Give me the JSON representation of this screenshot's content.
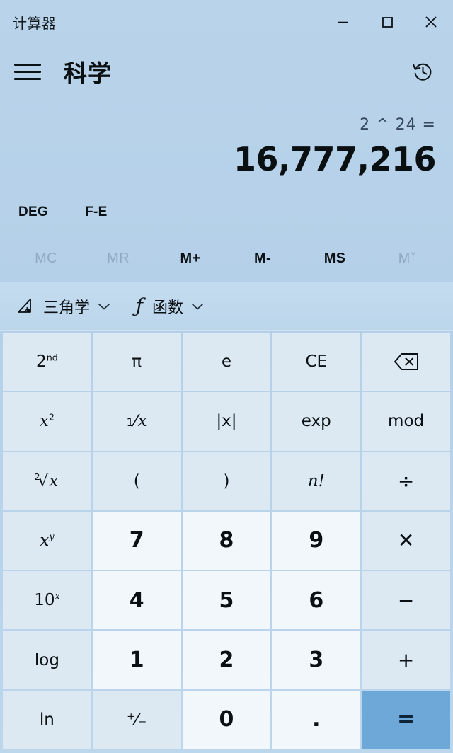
{
  "window": {
    "title": "计算器",
    "controls": [
      {
        "name": "minimize",
        "glyph": "minimize-icon"
      },
      {
        "name": "maximize",
        "glyph": "maximize-icon"
      },
      {
        "name": "close",
        "glyph": "close-icon"
      }
    ]
  },
  "header": {
    "menu_icon": "hamburger-icon",
    "mode_title": "科学",
    "history_icon": "history-icon"
  },
  "display": {
    "expression": "2 ^ 24 =",
    "result": "16,777,216"
  },
  "toggles": [
    {
      "label": "DEG",
      "name": "angle-unit-toggle",
      "state": "active"
    },
    {
      "label": "F-E",
      "name": "fe-toggle",
      "state": "active"
    }
  ],
  "memory": [
    {
      "label": "MC",
      "name": "memory-clear",
      "disabled": true
    },
    {
      "label": "MR",
      "name": "memory-recall",
      "disabled": true
    },
    {
      "label": "M+",
      "name": "memory-add",
      "disabled": false
    },
    {
      "label": "M-",
      "name": "memory-subtract",
      "disabled": false
    },
    {
      "label": "MS",
      "name": "memory-store",
      "disabled": false
    },
    {
      "label": "M",
      "caret": "˅",
      "name": "memory-dropdown",
      "disabled": true
    }
  ],
  "dropdowns": [
    {
      "label": "三角学",
      "icon": "triangle-icon",
      "name": "trigonometry-dropdown"
    },
    {
      "label": "函数",
      "icon": "function-f-icon",
      "name": "functions-dropdown"
    }
  ],
  "keypad": {
    "rows": [
      [
        {
          "name": "second-key",
          "type": "fn",
          "text": "2",
          "sup": "nd"
        },
        {
          "name": "pi-key",
          "type": "fn",
          "text": "π"
        },
        {
          "name": "euler-key",
          "type": "fn",
          "text": "e"
        },
        {
          "name": "clear-entry-key",
          "type": "fn",
          "text": "CE"
        },
        {
          "name": "backspace-key",
          "type": "icon",
          "icon": "backspace-icon"
        }
      ],
      [
        {
          "name": "square-key",
          "type": "fn",
          "ital": "x",
          "sup": "2"
        },
        {
          "name": "reciprocal-key",
          "type": "fn",
          "frac_num": "1",
          "frac_den": "x"
        },
        {
          "name": "absolute-value-key",
          "type": "fn",
          "text": "|x|"
        },
        {
          "name": "exp-key",
          "type": "fn",
          "text": "exp"
        },
        {
          "name": "mod-key",
          "type": "fn",
          "text": "mod"
        }
      ],
      [
        {
          "name": "square-root-key",
          "type": "root",
          "index": "2",
          "radicand": "x"
        },
        {
          "name": "open-paren-key",
          "type": "fn",
          "text": "("
        },
        {
          "name": "close-paren-key",
          "type": "fn",
          "text": ")"
        },
        {
          "name": "factorial-key",
          "type": "fn",
          "ital": "n",
          "text_after": "!"
        },
        {
          "name": "divide-key",
          "type": "op",
          "text": "÷"
        }
      ],
      [
        {
          "name": "power-key",
          "type": "fn",
          "ital": "x",
          "sup_ital": "y"
        },
        {
          "name": "digit-7-key",
          "type": "num",
          "text": "7"
        },
        {
          "name": "digit-8-key",
          "type": "num",
          "text": "8"
        },
        {
          "name": "digit-9-key",
          "type": "num",
          "text": "9"
        },
        {
          "name": "multiply-key",
          "type": "op",
          "text": "✕"
        }
      ],
      [
        {
          "name": "ten-power-key",
          "type": "fn",
          "text": "10",
          "sup_ital": "x"
        },
        {
          "name": "digit-4-key",
          "type": "num",
          "text": "4"
        },
        {
          "name": "digit-5-key",
          "type": "num",
          "text": "5"
        },
        {
          "name": "digit-6-key",
          "type": "num",
          "text": "6"
        },
        {
          "name": "subtract-key",
          "type": "op",
          "text": "−"
        }
      ],
      [
        {
          "name": "log-key",
          "type": "fn",
          "text": "log"
        },
        {
          "name": "digit-1-key",
          "type": "num",
          "text": "1"
        },
        {
          "name": "digit-2-key",
          "type": "num",
          "text": "2"
        },
        {
          "name": "digit-3-key",
          "type": "num",
          "text": "3"
        },
        {
          "name": "add-key",
          "type": "op",
          "text": "+"
        }
      ],
      [
        {
          "name": "ln-key",
          "type": "fn",
          "text": "ln"
        },
        {
          "name": "sign-toggle-key",
          "type": "fn",
          "text": "⁺⁄₋"
        },
        {
          "name": "digit-0-key",
          "type": "num",
          "text": "0"
        },
        {
          "name": "decimal-point-key",
          "type": "num",
          "text": "."
        },
        {
          "name": "equals-key",
          "type": "equals",
          "text": "="
        }
      ]
    ]
  },
  "colors": {
    "background_top": "#b9d3ea",
    "function_key": "#dce9f3",
    "number_key": "#f2f7fb",
    "equals_accent": "#6ea8d8",
    "text_primary": "#0a1013",
    "text_disabled": "#8fa9c0"
  }
}
